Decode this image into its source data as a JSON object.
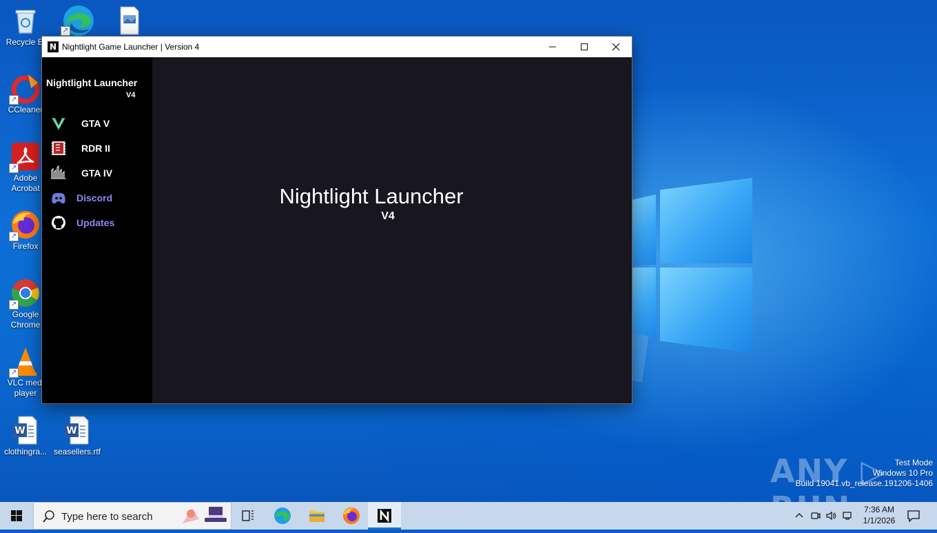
{
  "window": {
    "title": "Nightlight Game Launcher | Version 4",
    "app_icon_letter": "N",
    "min_glyph": "—",
    "max_glyph": "☐",
    "close_glyph": "✕"
  },
  "sidebar": {
    "title": "Nightlight Launcher",
    "version": "V4",
    "items": [
      {
        "label": "GTA V",
        "icon": "gta-v-icon"
      },
      {
        "label": "RDR II",
        "icon": "rdr-ii-icon"
      },
      {
        "label": "GTA IV",
        "icon": "gta-iv-icon"
      },
      {
        "label": "Discord",
        "icon": "discord-icon",
        "color": "#8b87f2"
      },
      {
        "label": "Updates",
        "icon": "github-icon",
        "color": "#8b87f2"
      }
    ]
  },
  "main": {
    "title": "Nightlight Launcher",
    "version": "V4"
  },
  "desktop": {
    "icons": [
      {
        "label": "Recycle Bin",
        "display": "Recycle Bi",
        "icon": "recycle-bin-icon"
      },
      {
        "label": "CCleaner",
        "display": "CCleaner",
        "icon": "ccleaner-icon"
      },
      {
        "label": "Adobe Acrobat",
        "display": "Adobe\nAcrobat",
        "icon": "acrobat-icon"
      },
      {
        "label": "Firefox",
        "display": "Firefox",
        "icon": "firefox-icon"
      },
      {
        "label": "Google Chrome",
        "display": "Google\nChrome",
        "icon": "chrome-icon"
      },
      {
        "label": "VLC media player",
        "display": "VLC medi\nplayer",
        "icon": "vlc-icon"
      },
      {
        "label": "clothingra...",
        "display": "clothingra...",
        "icon": "word-document-icon"
      },
      {
        "label": "seasellers.rtf",
        "display": "seasellers.rtf",
        "icon": "word-document-icon"
      },
      {
        "label": "",
        "display": "",
        "icon": "edge-icon"
      },
      {
        "label": "",
        "display": "",
        "icon": "image-file-icon"
      }
    ],
    "watermark": {
      "line1": "Test Mode",
      "line2": "Windows 10 Pro",
      "line3": "Build 19041.vb_release.191206-1406"
    },
    "anyrun_text": "ANY ▷ RUN"
  },
  "taskbar": {
    "search_placeholder": "Type here to search",
    "apps": [
      "task-view-icon",
      "edge-icon",
      "file-explorer-icon",
      "firefox-icon",
      "nightlight-launcher-icon"
    ],
    "active_app": "nightlight-launcher-icon",
    "clock_time": "7:36 AM",
    "clock_date": "1/1/2026"
  },
  "colors": {
    "sidebar_bg": "#000000",
    "panel_bg": "#18161f",
    "link_color": "#8b87f2",
    "desktop_blue": "#0a6ad0"
  }
}
